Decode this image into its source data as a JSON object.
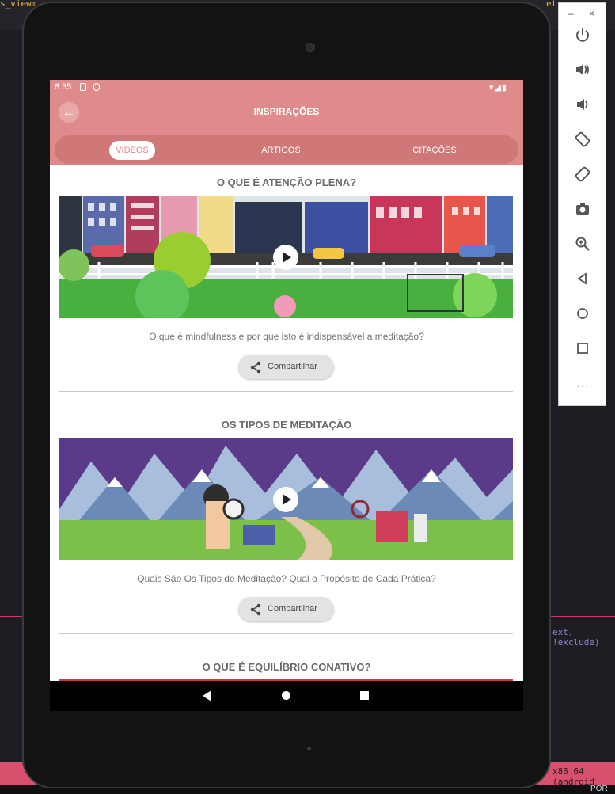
{
  "status_bar": {
    "time": "8:35",
    "right_icons": "▾◢▮"
  },
  "app_bar": {
    "title": "INSPIRAÇÕES",
    "back_icon": "arrow-left-icon"
  },
  "tabs": [
    {
      "label": "VÍDEOS",
      "active": true
    },
    {
      "label": "ARTIGOS",
      "active": false
    },
    {
      "label": "CITAÇÕES",
      "active": false
    }
  ],
  "videos": [
    {
      "title": "O QUE É ATENÇÃO PLENA?",
      "caption": "O que é mindfulness e por que isto é indispensável a meditação?",
      "share_label": "Compartilhar"
    },
    {
      "title": "OS TIPOS DE MEDITAÇÃO",
      "caption": "Quais São Os Tipos de Meditação? Qual o Propósito de Cada Prática?",
      "share_label": "Compartilhar"
    },
    {
      "title": "O QUE É EQUILÍBRIO CONATIVO?"
    }
  ],
  "emulator_panel": {
    "minimize": "–",
    "close": "×",
    "more": "···"
  },
  "desktop": {
    "top_left_text": "s_viewm",
    "top_right_text": "et.c",
    "exclude_text": "ext, !exclude)",
    "arch_text": "x86 64 (android",
    "lang": "POR"
  },
  "colors": {
    "accent": "#e08b8b",
    "tab_track": "#d07777"
  }
}
